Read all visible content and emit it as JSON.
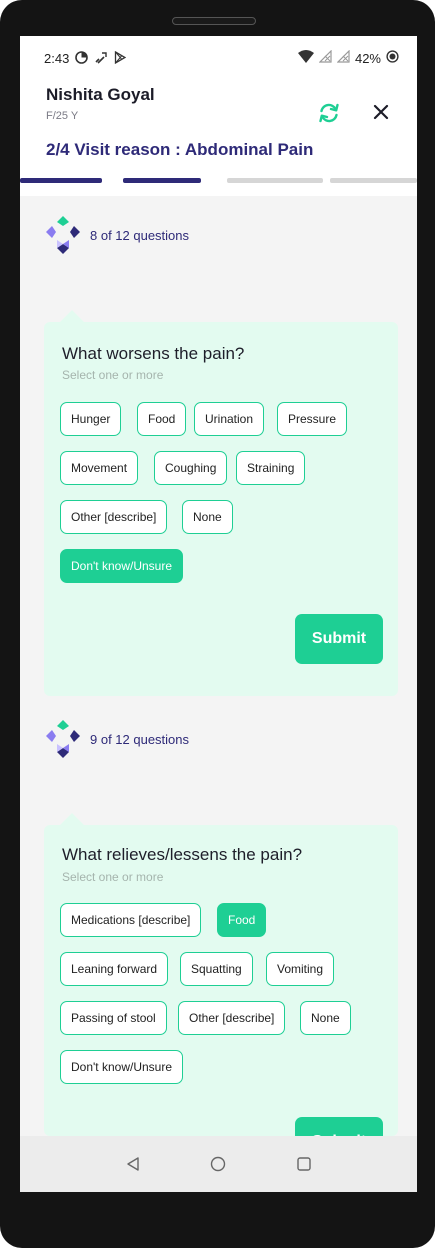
{
  "status_bar": {
    "time": "2:43",
    "battery": "42%",
    "left_icons": [
      "data-saver-icon",
      "wifi-calling-icon",
      "play-store-icon"
    ],
    "right_icons": [
      "wifi-icon",
      "no-signal-icon",
      "no-signal-icon",
      "battery-icon"
    ]
  },
  "header": {
    "patient_name": "Nishita Goyal",
    "patient_meta": "F/25 Y",
    "visit_title": "2/4 Visit reason : Abdominal Pain"
  },
  "progress": {
    "total_steps": 4,
    "current_step": 2,
    "colors": {
      "active": "#2e2a78",
      "inactive": "#d6d6d6"
    }
  },
  "questions": [
    {
      "counter": "8 of 12 questions",
      "title": "What worsens the pain?",
      "subtitle": "Select one or more",
      "options": [
        {
          "label": "Hunger",
          "selected": false
        },
        {
          "label": "Food",
          "selected": false
        },
        {
          "label": "Urination",
          "selected": false
        },
        {
          "label": "Pressure",
          "selected": false
        },
        {
          "label": "Movement",
          "selected": false
        },
        {
          "label": "Coughing",
          "selected": false
        },
        {
          "label": "Straining",
          "selected": false
        },
        {
          "label": "Other [describe]",
          "selected": false
        },
        {
          "label": "None",
          "selected": false
        },
        {
          "label": "Don't know/Unsure",
          "selected": true
        }
      ],
      "submit_label": "Submit"
    },
    {
      "counter": "9 of 12 questions",
      "title": "What relieves/lessens the pain?",
      "subtitle": "Select one or more",
      "options": [
        {
          "label": "Medications [describe]",
          "selected": false
        },
        {
          "label": "Food",
          "selected": true
        },
        {
          "label": "Leaning forward",
          "selected": false
        },
        {
          "label": "Squatting",
          "selected": false
        },
        {
          "label": "Vomiting",
          "selected": false
        },
        {
          "label": "Passing of stool",
          "selected": false
        },
        {
          "label": "Other [describe]",
          "selected": false
        },
        {
          "label": "None",
          "selected": false
        },
        {
          "label": "Don't know/Unsure",
          "selected": false
        }
      ],
      "submit_label": "Submit"
    }
  ],
  "colors": {
    "accent": "#1ecf94",
    "brand": "#2e2a78",
    "card_bg": "#e3fbf0"
  },
  "nav_bar": {
    "icons": [
      "back-icon",
      "home-icon",
      "recents-icon"
    ]
  }
}
